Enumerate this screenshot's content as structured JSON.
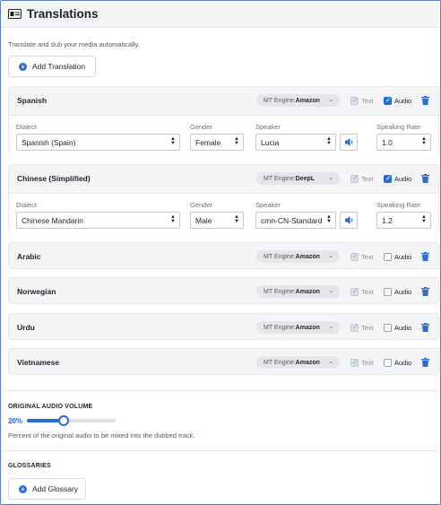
{
  "header": {
    "title": "Translations"
  },
  "subtitle": "Translate and dub your media automatically.",
  "add_translation_label": "Add Translation",
  "labels": {
    "dialect": "Dialect",
    "gender": "Gender",
    "speaker": "Speaker",
    "speaking_rate": "Speaking Rate",
    "text": "Text",
    "audio": "Audio",
    "mt_prefix": "MT Engine:"
  },
  "translations": [
    {
      "language": "Spanish",
      "mt_engine": "Amazon",
      "text_checked": true,
      "audio_checked": true,
      "dialect": "Spanish (Spain)",
      "gender": "Female",
      "speaker": "Lucia",
      "speaking_rate": "1.0"
    },
    {
      "language": "Chinese (Simplified)",
      "mt_engine": "DeepL",
      "text_checked": true,
      "audio_checked": true,
      "dialect": "Chinese Mandarin",
      "gender": "Male",
      "speaker": "cmn-CN-Standard",
      "speaking_rate": "1.2"
    },
    {
      "language": "Arabic",
      "mt_engine": "Amazon",
      "text_checked": true,
      "audio_checked": false
    },
    {
      "language": "Norwegian",
      "mt_engine": "Amazon",
      "text_checked": true,
      "audio_checked": false
    },
    {
      "language": "Urdu",
      "mt_engine": "Amazon",
      "text_checked": true,
      "audio_checked": false
    },
    {
      "language": "Vietnamese",
      "mt_engine": "Amazon",
      "text_checked": true,
      "audio_checked": false
    }
  ],
  "original_audio": {
    "label": "ORIGINAL AUDIO VOLUME",
    "value_text": "20%",
    "value": 0.2,
    "help": "Percent of the original audio to be mixed into the dubbed track."
  },
  "glossaries": {
    "label": "GLOSSARIES",
    "add_label": "Add Glossary"
  },
  "colors": {
    "accent": "#2a6bd8",
    "panel": "#f4f5f7",
    "border": "#e6e8eb"
  },
  "icons": {
    "header": "id-card-icon",
    "add": "plus-circle-icon",
    "delete": "trash-icon",
    "speaker": "speaker-icon",
    "dropdown": "chevron-down-icon"
  }
}
